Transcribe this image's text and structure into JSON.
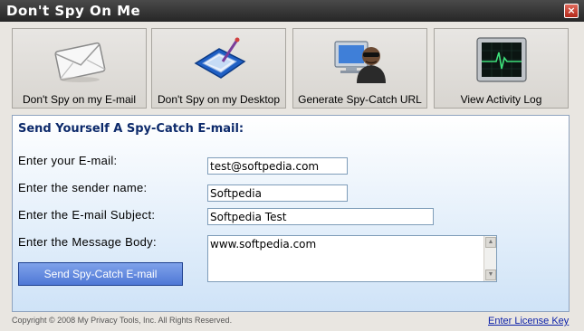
{
  "window": {
    "title": "Don't Spy On Me",
    "close_glyph": "×"
  },
  "nav": [
    {
      "label": "Don't Spy on my E-mail",
      "icon": "envelope-icon"
    },
    {
      "label": "Don't Spy on my Desktop",
      "icon": "desktop-pen-icon"
    },
    {
      "label": "Generate Spy-Catch URL",
      "icon": "spy-monitor-icon"
    },
    {
      "label": "View Activity Log",
      "icon": "activity-monitor-icon"
    }
  ],
  "form": {
    "title": "Send Yourself A Spy-Catch E-mail:",
    "email_label": "Enter your E-mail:",
    "email_value": "test@softpedia.com",
    "sender_label": "Enter the sender name:",
    "sender_value": "Softpedia",
    "subject_label": "Enter the E-mail Subject:",
    "subject_value": "Softpedia Test",
    "body_label": "Enter the Message Body:",
    "body_value": "www.softpedia.com",
    "send_label": "Send Spy-Catch E-mail"
  },
  "footer": {
    "copyright": "Copyright © 2008 My Privacy Tools, Inc. All Rights Reserved.",
    "license_link": "Enter License Key"
  }
}
